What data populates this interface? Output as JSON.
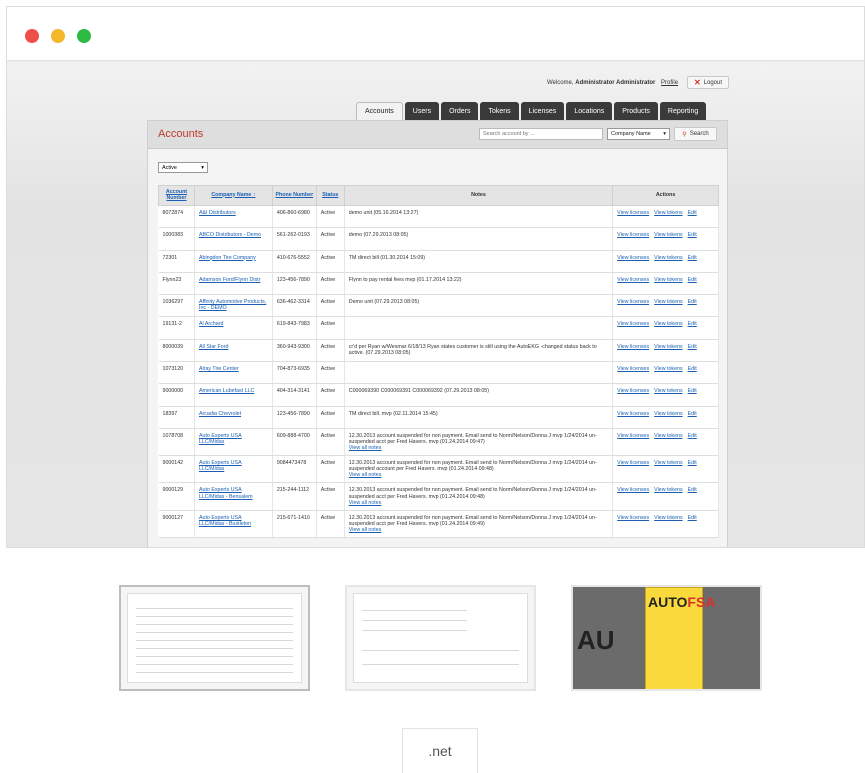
{
  "app": {
    "welcome_prefix": "Welcome,",
    "user_name": "Administrator Administrator",
    "profile_link": "Profile",
    "logout_label": "Logout"
  },
  "tabs": [
    {
      "label": "Accounts",
      "active": true
    },
    {
      "label": "Users",
      "active": false
    },
    {
      "label": "Orders",
      "active": false
    },
    {
      "label": "Tokens",
      "active": false
    },
    {
      "label": "Licenses",
      "active": false
    },
    {
      "label": "Locations",
      "active": false
    },
    {
      "label": "Products",
      "active": false
    },
    {
      "label": "Reporting",
      "active": false
    }
  ],
  "panel": {
    "title": "Accounts",
    "search_placeholder": "Search account by ...",
    "search_field_value": "Company Name",
    "search_button": "Search",
    "status_filter": "Active"
  },
  "table": {
    "headers": {
      "account_number": "Account Number",
      "company_name": "Company Name ↑",
      "phone_number": "Phone Number",
      "status": "Status",
      "notes": "Notes",
      "actions": "Actions"
    },
    "action_labels": {
      "view_licenses": "View licenses",
      "view_tokens": "View tokens",
      "edit": "Edit",
      "view_all_notes": "View all notes"
    },
    "rows": [
      {
        "account": "8072874",
        "company": "A&I Distributors",
        "phone": "406-860-6980",
        "status": "Active",
        "notes": "demo unit (05.16.2014 13:27)",
        "all_notes": false
      },
      {
        "account": "1000383",
        "company": "ABCO Distributors - Demo",
        "phone": "561-262-0193",
        "status": "Active",
        "notes": "demo (07.29.2013 08:05)",
        "all_notes": false
      },
      {
        "account": "72301",
        "company": "Abingdon Tire Company",
        "phone": "410-676-5552",
        "status": "Active",
        "notes": "TM direct bill (01.30.2014 15:09)",
        "all_notes": false
      },
      {
        "account": "Flynn23",
        "company": "Adamson Ford/Flynn Distr",
        "phone": "123-456-7890",
        "status": "Active",
        "notes": "Flynn to pay rental fees mvp (01.17.2014 13:22)",
        "all_notes": false
      },
      {
        "account": "1036297",
        "company": "Affinity Automotive Products, Inc - DEMO",
        "phone": "636-462-3314",
        "status": "Active",
        "notes": "Demo unit (07.29.2013 08:05)",
        "all_notes": false
      },
      {
        "account": "19131-2",
        "company": "Al Archard",
        "phone": "619-843-7983",
        "status": "Active",
        "notes": "",
        "all_notes": false
      },
      {
        "account": "8000039",
        "company": "All Star Ford",
        "phone": "360-943-9300",
        "status": "Active",
        "notes": "cr'd per Ryan w/Wesmar 6/18/13 Ryan states customer is still using the AutoEKG -changed status back to active. (07.29.2013 08:05)",
        "all_notes": false
      },
      {
        "account": "1073120",
        "company": "Alray Tire Center",
        "phone": "704-873-6935",
        "status": "Active",
        "notes": "",
        "all_notes": false
      },
      {
        "account": "9000000",
        "company": "American Lubefast LLC",
        "phone": "404-314-3141",
        "status": "Active",
        "notes": "C000069390 C000069391 C000069392 (07.29.2013 08:05)",
        "all_notes": false
      },
      {
        "account": "18397",
        "company": "Arcadia Chevrolet",
        "phone": "123-456-7890",
        "status": "Active",
        "notes": "TM direct bill. mvp (02.11.2014 15:45)",
        "all_notes": false
      },
      {
        "account": "1078708",
        "company": "Auto Experts USA LLC/Midas",
        "phone": "609-888-4700",
        "status": "Active",
        "notes": "12.30.2013 account suspended for non payment. Email send to Norm/Nelson/Donna J mvp 1/24/2014 un-suspended acct per Fred Havers. mvp (01.24.2014 09:47)",
        "all_notes": true
      },
      {
        "account": "9000142",
        "company": "Auto Experts USA LLC/Midas",
        "phone": "9084473478",
        "status": "Active",
        "notes": "12.30.2013 account suspended for non payment. Email send to Norm/Nelson/Donna J mvp 1/24/2014 un-suspended account per Fred Havers. mvp (01.24.2014 09:48)",
        "all_notes": true
      },
      {
        "account": "9000129",
        "company": "Auto Experts USA LLC/Midas - Bensalem",
        "phone": "215-244-1112",
        "status": "Active",
        "notes": "12.30.2013 account suspended for non payment. Email send to Norm/Nelson/Donna J mvp 1/24/2014 un-suspended acct per Fred Havers. mvp (01.24.2014 09:48)",
        "all_notes": true
      },
      {
        "account": "9000127",
        "company": "Auto Experts USA LLC/Midas - Bustleton",
        "phone": "215-671-1410",
        "status": "Active",
        "notes": "12.30.2013 account suspended for non payment. Email send to Norm/Nelson/Donna J mvp 1/24/2014 un-suspended acct per Fred Havers. mvp (01.24.2014 09:49)",
        "all_notes": true
      }
    ]
  },
  "thumbnail_text": {
    "fsa_logo_auto": "AUTO",
    "fsa_logo_fsa": "FSA",
    "au_text": "AU"
  },
  "tech_label": ".net",
  "colors": {
    "accent_red": "#c0392b",
    "link_blue": "#1a5fb4",
    "tab_dark": "#3a3a3a"
  }
}
